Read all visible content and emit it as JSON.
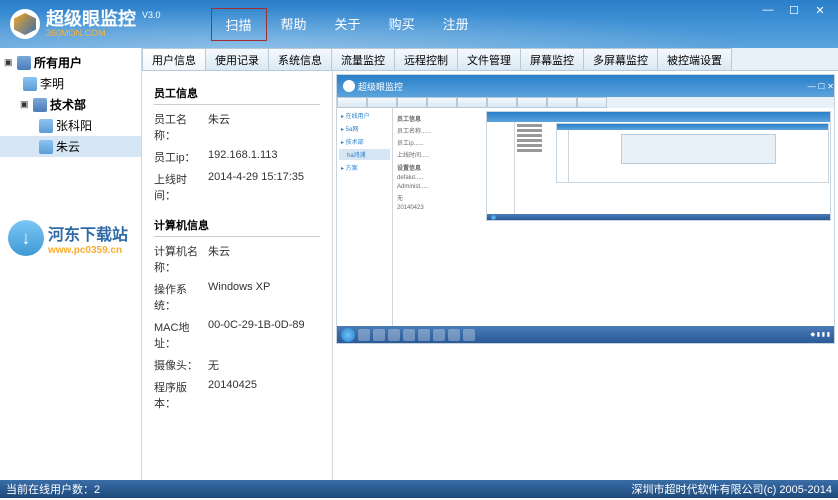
{
  "brand": {
    "name": "超级眼监控",
    "sub": "360MON.COM",
    "version": "V3.0"
  },
  "menu": [
    "扫描",
    "帮助",
    "关于",
    "购买",
    "注册"
  ],
  "tree": {
    "root": "所有用户",
    "users": [
      {
        "name": "李明",
        "children": []
      },
      {
        "name": "技术部",
        "children": [
          "张科阳",
          "朱云"
        ]
      }
    ],
    "selected": "朱云"
  },
  "tabs": [
    "用户信息",
    "使用记录",
    "系统信息",
    "流量监控",
    "远程控制",
    "文件管理",
    "屏幕监控",
    "多屏幕监控",
    "被控端设置"
  ],
  "active_tab": 0,
  "info": {
    "section1": "员工信息",
    "rows1": [
      {
        "label": "员工名称：",
        "value": "朱云"
      },
      {
        "label": "员工ip：",
        "value": "192.168.1.113"
      },
      {
        "label": "上线时间：",
        "value": "2014-4-29 15:17:35"
      }
    ],
    "section2": "计算机信息",
    "rows2": [
      {
        "label": "计算机名称：",
        "value": "朱云"
      },
      {
        "label": "操作系统：",
        "value": "Windows XP"
      },
      {
        "label": "MAC地址：",
        "value": "00-0C-29-1B-0D-89"
      },
      {
        "label": "摄像头：",
        "value": "无"
      },
      {
        "label": "程序版本：",
        "value": "20140425"
      }
    ]
  },
  "status": {
    "left": "当前在线用户数：2",
    "right": "深圳市超时代软件有限公司(c) 2005-2014"
  },
  "watermark": {
    "line1": "河东下载站",
    "line2": "www.pc0359.cn"
  }
}
